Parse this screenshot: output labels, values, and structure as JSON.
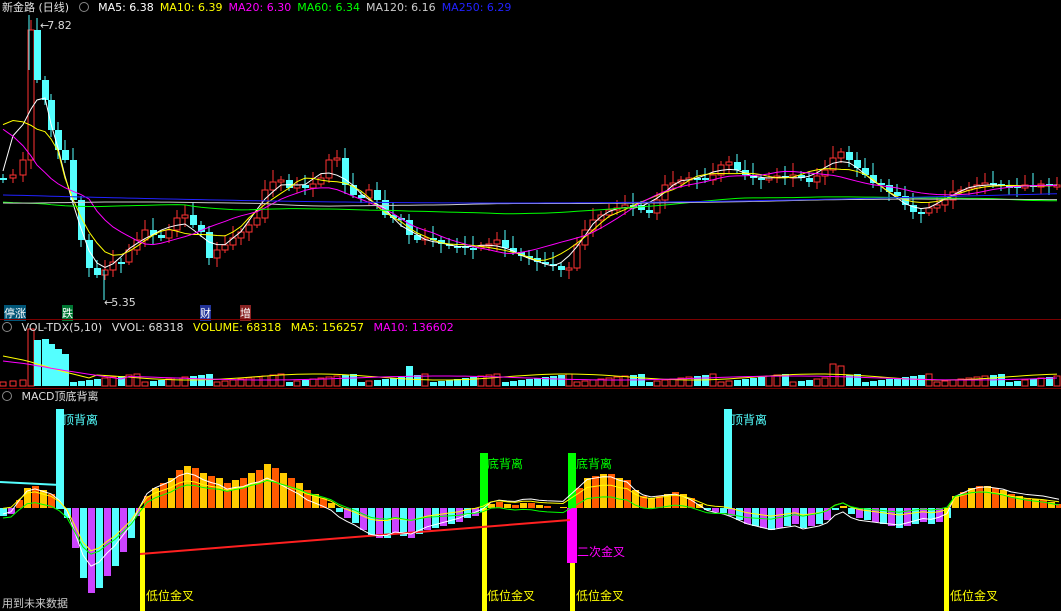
{
  "main": {
    "title": "新金路 (日线)",
    "ma": [
      {
        "label": "MA5: 6.38",
        "color": "#ffffff"
      },
      {
        "label": "MA10: 6.39",
        "color": "#ffff00"
      },
      {
        "label": "MA20: 6.30",
        "color": "#ff00ff"
      },
      {
        "label": "MA60: 6.34",
        "color": "#00ff00"
      },
      {
        "label": "MA120: 6.16",
        "color": "#cccccc"
      },
      {
        "label": "MA250: 6.29",
        "color": "#2222ff"
      }
    ],
    "high_label": "7.82",
    "low_label": "5.35",
    "tags": [
      "停涨",
      "跌",
      "财",
      "增"
    ]
  },
  "vol": {
    "name": "VOL-TDX(5,10)",
    "vvol": "VVOL: 68318",
    "volume": "VOLUME: 68318",
    "ma5": "MA5: 156257",
    "ma10": "MA10: 136602"
  },
  "macd": {
    "name": "MACD顶底背离",
    "labels": {
      "top_div_1": "顶背离",
      "top_div_2": "顶背离",
      "bottom_div_1": "底背离",
      "bottom_div_2": "底背离",
      "low_cross_1": "低位金叉",
      "low_cross_2": "低位金叉",
      "low_cross_3": "低位金叉",
      "low_cross_4": "低位金叉",
      "second_cross": "二次金叉"
    },
    "footer": "用到未来数据"
  },
  "colors": {
    "up": "#ff3232",
    "down": "#54ffff",
    "divider": "#7a0000"
  },
  "chart_data": [
    {
      "type": "candlestick",
      "title": "新金路 (日线)",
      "ylim": [
        5.35,
        7.82
      ],
      "annotations": [
        "7.82",
        "5.35"
      ],
      "series": [
        {
          "name": "MA5",
          "last": 6.38
        },
        {
          "name": "MA10",
          "last": 6.39
        },
        {
          "name": "MA20",
          "last": 6.3
        },
        {
          "name": "MA60",
          "last": 6.34
        },
        {
          "name": "MA120",
          "last": 6.16
        },
        {
          "name": "MA250",
          "last": 6.29
        }
      ]
    },
    {
      "type": "bar",
      "title": "VOL-TDX(5,10)",
      "series": [
        {
          "name": "VVOL",
          "last": 68318
        },
        {
          "name": "VOLUME",
          "last": 68318
        },
        {
          "name": "MA5",
          "last": 156257
        },
        {
          "name": "MA10",
          "last": 136602
        }
      ]
    },
    {
      "type": "bar",
      "title": "MACD顶底背离",
      "annotations": [
        "顶背离",
        "底背离",
        "低位金叉",
        "二次金叉"
      ]
    }
  ]
}
